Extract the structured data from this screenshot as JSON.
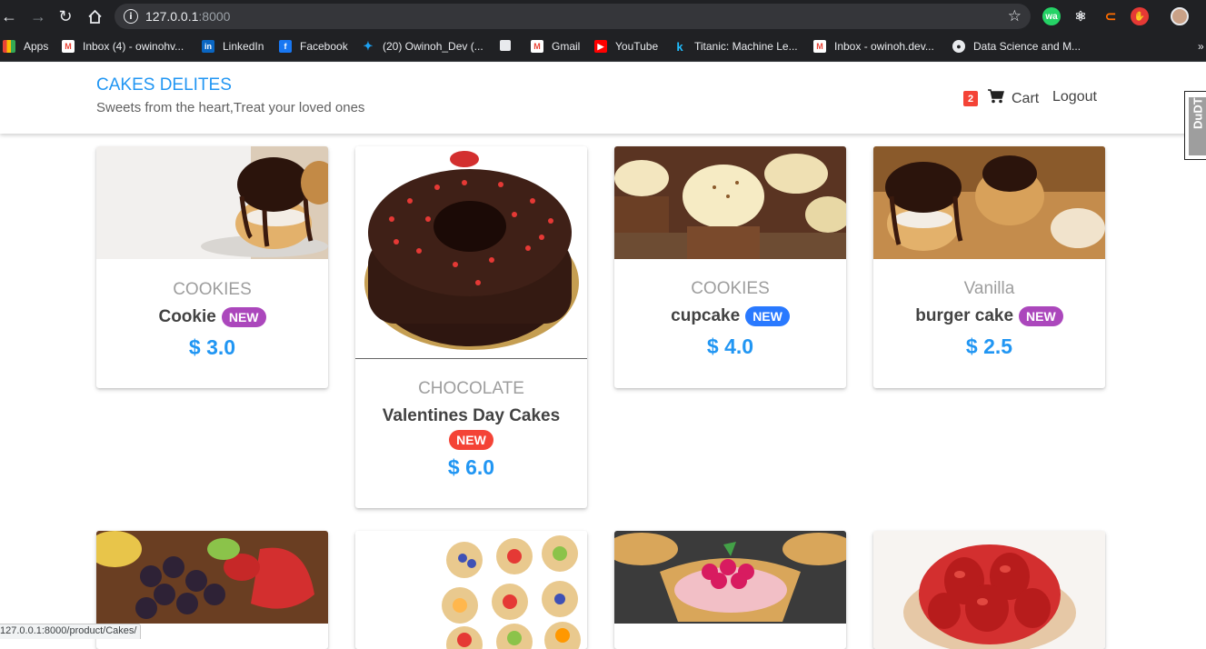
{
  "browser": {
    "url_host": "127.0.0.1",
    "url_port": ":8000",
    "bookmarks": [
      {
        "label": "Apps",
        "color": "#e8eaed"
      },
      {
        "label": "Inbox (4) - owinohv...",
        "color": "#ea4335"
      },
      {
        "label": "LinkedIn",
        "color": "#0a66c2"
      },
      {
        "label": "Facebook",
        "color": "#1877f2"
      },
      {
        "label": "(20) Owinoh_Dev (...",
        "color": "#1da1f2"
      },
      {
        "label": "Gmail",
        "color": "#ea4335"
      },
      {
        "label": "YouTube",
        "color": "#ff0000"
      },
      {
        "label": "Titanic: Machine Le...",
        "color": "#20beff"
      },
      {
        "label": "Inbox - owinoh.dev...",
        "color": "#ea4335"
      },
      {
        "label": "Data Science and M...",
        "color": "#e8eaed"
      }
    ],
    "status_url": "127.0.0.1:8000/product/Cakes/"
  },
  "header": {
    "brand": "CAKES DELITES",
    "tagline": "Sweets from the heart,Treat your loved ones",
    "cart_count": "2",
    "cart_label": "Cart",
    "logout_label": "Logout",
    "side_tab": "DuDT"
  },
  "products": [
    {
      "category": "COOKIES",
      "name": "Cookie",
      "badge": "NEW",
      "badge_color": "#ab47bc",
      "price": "$ 3.0",
      "image": "chocolate-profiterole"
    },
    {
      "category": "CHOCOLATE",
      "name": "Valentines Day Cakes",
      "badge": "NEW",
      "badge_color": "#f44336",
      "price": "$ 6.0",
      "image": "chocolate-bundt-cake"
    },
    {
      "category": "COOKIES",
      "name": "cupcake",
      "badge": "NEW",
      "badge_color": "#2979ff",
      "price": "$ 4.0",
      "image": "cupcakes"
    },
    {
      "category": "Vanilla",
      "name": "burger cake",
      "badge": "NEW",
      "badge_color": "#ab47bc",
      "price": "$ 2.5",
      "image": "chocolate-profiterole"
    }
  ],
  "row2_images": [
    "fruit-tart",
    "mini-fruit-tarts",
    "raspberry-tart",
    "strawberry-tart"
  ],
  "colors": {
    "accent": "#2196f3",
    "badge_red": "#f44336"
  }
}
